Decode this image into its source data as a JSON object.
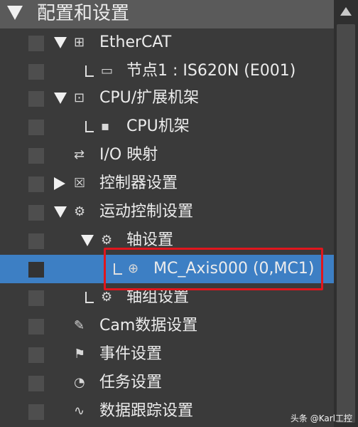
{
  "header": {
    "title": "配置和设置"
  },
  "tree": [
    {
      "id": "ethercat",
      "label": "EtherCAT",
      "icon": "ethercat-icon",
      "glyph": "⊞",
      "expander": "down"
    },
    {
      "id": "node1",
      "label": "节点1 : IS620N (E001)",
      "icon": "node-icon",
      "glyph": "▭",
      "elbow": true
    },
    {
      "id": "cpu-rack",
      "label": "CPU/扩展机架",
      "icon": "rack-icon",
      "glyph": "⊡",
      "expander": "down"
    },
    {
      "id": "cpu-frame",
      "label": "CPU机架",
      "icon": "cpu-frame-icon",
      "glyph": "▪",
      "elbow": true
    },
    {
      "id": "io-map",
      "label": "I/O 映射",
      "icon": "io-map-icon",
      "glyph": "⇄"
    },
    {
      "id": "controller-settings",
      "label": "控制器设置",
      "icon": "controller-icon",
      "glyph": "☒",
      "expander": "right"
    },
    {
      "id": "motion-settings",
      "label": "运动控制设置",
      "icon": "gear-icon",
      "glyph": "⚙",
      "expander": "down"
    },
    {
      "id": "axis-settings",
      "label": "轴设置",
      "icon": "gear-icon",
      "glyph": "⚙",
      "expander": "down"
    },
    {
      "id": "mc-axis000",
      "label": "MC_Axis000 (0,MC1)",
      "icon": "axis-icon",
      "glyph": "⊕",
      "elbow": true,
      "selected": true
    },
    {
      "id": "axis-group",
      "label": "轴组设置",
      "icon": "axis-group-icon",
      "glyph": "⚙",
      "elbow": true
    },
    {
      "id": "cam-data",
      "label": "Cam数据设置",
      "icon": "cam-icon",
      "glyph": "✎"
    },
    {
      "id": "event-settings",
      "label": "事件设置",
      "icon": "flag-icon",
      "glyph": "⚑"
    },
    {
      "id": "task-settings",
      "label": "任务设置",
      "icon": "task-icon",
      "glyph": "◔"
    },
    {
      "id": "trace-settings",
      "label": "数据跟踪设置",
      "icon": "trace-icon",
      "glyph": "∿"
    }
  ],
  "watermark": "头条 @Karl工控",
  "colors": {
    "background": "#3a3a3a",
    "selected": "#3d7fc4",
    "highlight": "#e0161d"
  }
}
